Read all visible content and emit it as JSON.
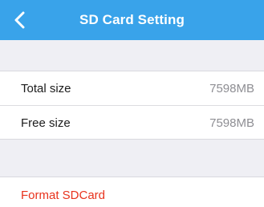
{
  "navbar": {
    "title": "SD Card Setting",
    "back_icon": "chevron-left-icon",
    "background_color": "#39a3ea"
  },
  "storage": {
    "total": {
      "label": "Total size",
      "value": "7598MB"
    },
    "free": {
      "label": "Free size",
      "value": "7598MB"
    }
  },
  "actions": {
    "format_label": "Format SDCard",
    "format_color": "#e8321c"
  }
}
